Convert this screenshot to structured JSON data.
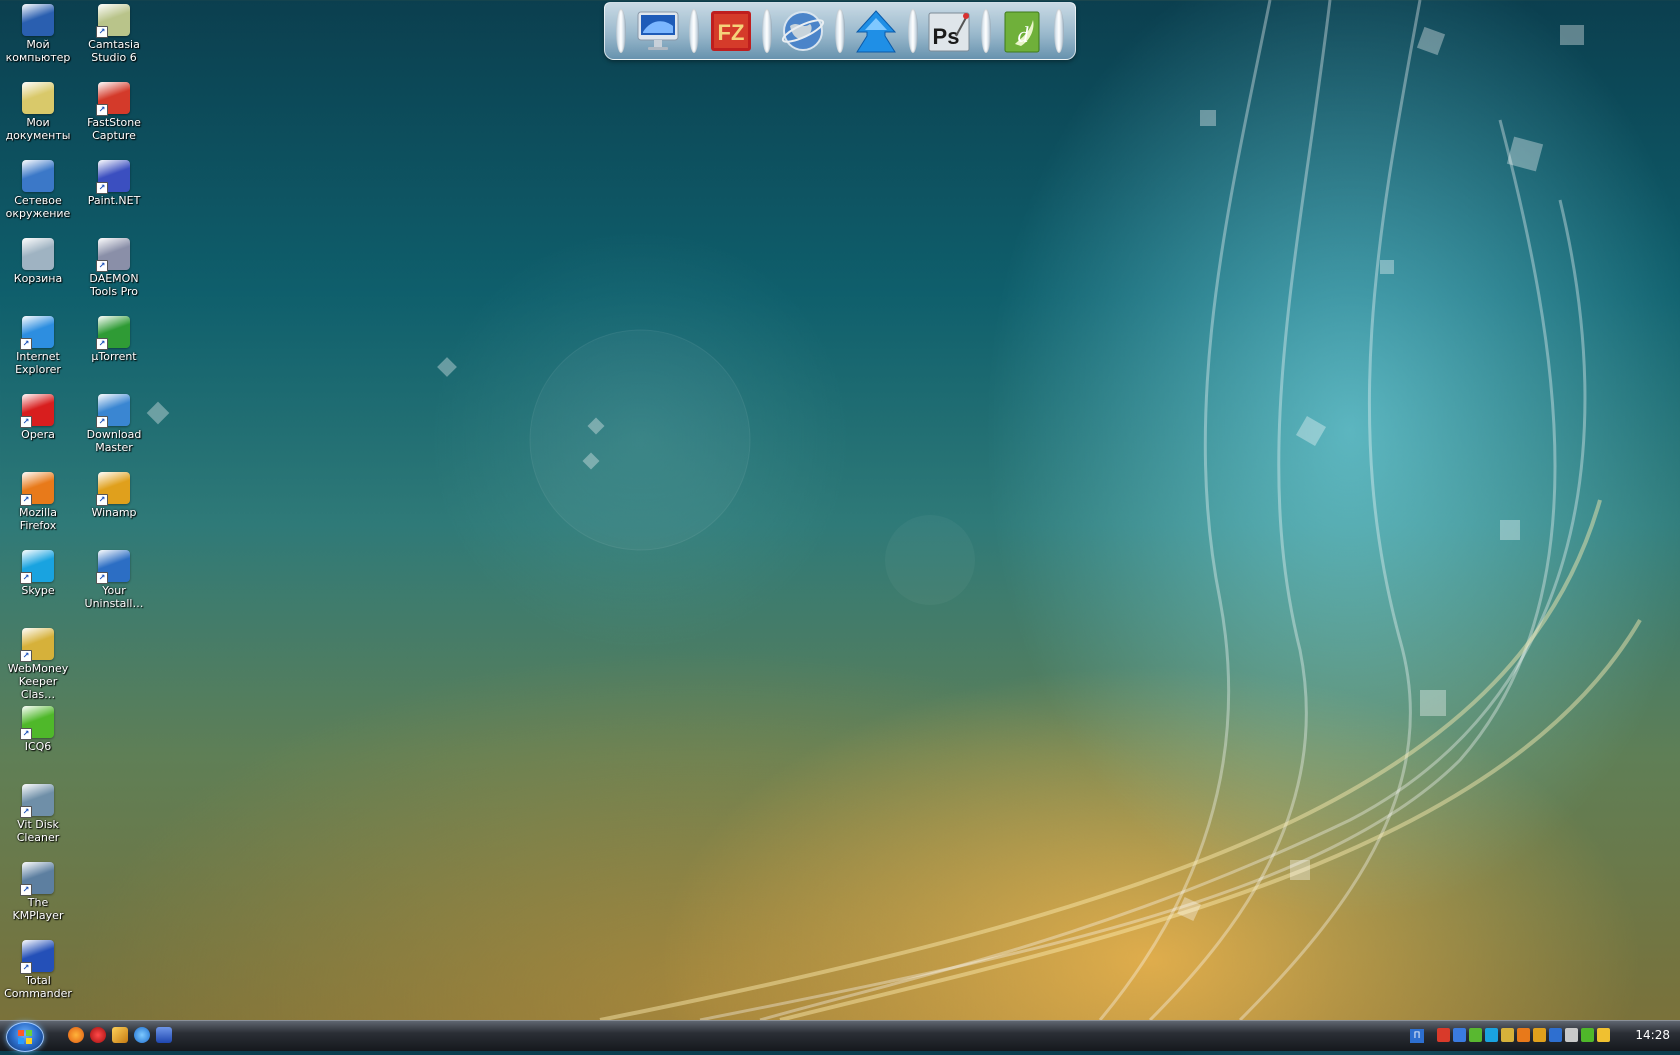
{
  "desktop": {
    "icons": [
      {
        "label": "Мой компьютер",
        "icon": "my-computer-icon",
        "color": "#2a5fb0"
      },
      {
        "label": "Мои документы",
        "icon": "my-documents-icon",
        "color": "#d9c96a"
      },
      {
        "label": "Сетевое окружение",
        "icon": "network-icon",
        "color": "#3b78c8"
      },
      {
        "label": "Корзина",
        "icon": "recycle-bin-icon",
        "color": "#9fb3c2"
      },
      {
        "label": "Internet Explorer",
        "icon": "internet-explorer-icon",
        "color": "#2d8ee0"
      },
      {
        "label": "Opera",
        "icon": "opera-icon",
        "color": "#d81e1e"
      },
      {
        "label": "Mozilla Firefox",
        "icon": "firefox-icon",
        "color": "#e87a1a"
      },
      {
        "label": "Skype",
        "icon": "skype-icon",
        "color": "#19a3e0"
      },
      {
        "label": "WebMoney Keeper Clas…",
        "icon": "webmoney-icon",
        "color": "#d6b13a"
      },
      {
        "label": "ICQ6",
        "icon": "icq-icon",
        "color": "#4fb82a"
      },
      {
        "label": "Vit Disk Cleaner",
        "icon": "disk-cleaner-icon",
        "color": "#6f8fa8"
      },
      {
        "label": "The KMPlayer",
        "icon": "kmplayer-icon",
        "color": "#5d7fa0"
      },
      {
        "label": "Total Commander",
        "icon": "total-commander-icon",
        "color": "#2450b8"
      },
      {
        "label": "Camtasia Studio 6",
        "icon": "camtasia-icon",
        "color": "#b9c48a"
      },
      {
        "label": "FastStone Capture",
        "icon": "faststone-icon",
        "color": "#d43a2a"
      },
      {
        "label": "Paint.NET",
        "icon": "paint-net-icon",
        "color": "#3b4fc0"
      },
      {
        "label": "DAEMON Tools Pro",
        "icon": "daemon-tools-icon",
        "color": "#8a8fa8"
      },
      {
        "label": "µTorrent",
        "icon": "utorrent-icon",
        "color": "#2f9b35"
      },
      {
        "label": "Download Master",
        "icon": "download-master-icon",
        "color": "#3a86d2"
      },
      {
        "label": "Winamp",
        "icon": "winamp-icon",
        "color": "#e0a01c"
      },
      {
        "label": "Your Uninstall…",
        "icon": "your-uninstaller-icon",
        "color": "#2c6ec4"
      }
    ]
  },
  "dock": {
    "items": [
      {
        "icon": "imac-icon"
      },
      {
        "icon": "filezilla-icon",
        "text": "FZ"
      },
      {
        "icon": "globe-icon"
      },
      {
        "icon": "blue-arrow-icon"
      },
      {
        "icon": "photoshop-icon",
        "text": "Ps"
      },
      {
        "icon": "dreamweaver-icon"
      }
    ]
  },
  "taskbar": {
    "quick_launch": [
      "firefox-icon",
      "opera-icon",
      "winamp-icon",
      "internet-explorer-icon",
      "show-desktop-icon"
    ],
    "tray_icons": [
      "antivirus-icon",
      "network-icon",
      "icq-icon",
      "skype-icon",
      "webmoney-icon",
      "firefox-icon",
      "messenger-icon",
      "display-icon",
      "volume-icon",
      "download-icon",
      "tools-icon"
    ],
    "language": "П",
    "clock": "14:28"
  }
}
